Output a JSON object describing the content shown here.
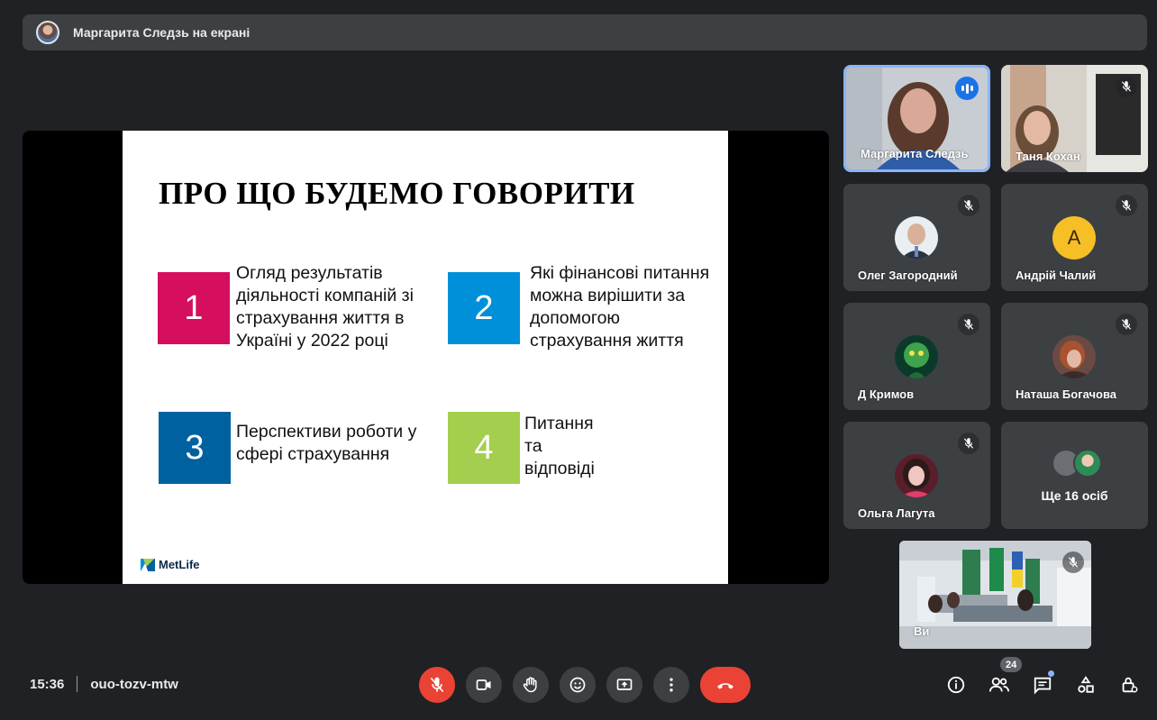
{
  "banner": {
    "text": "Маргарита Следзь на екрані"
  },
  "slide": {
    "title": "ПРО ЩО БУДЕМО ГОВОРИТИ",
    "items": [
      {
        "number": "1",
        "text": "Огляд результатів\nдіяльності компаній зі\nстрахування життя в\nУкраїні у 2022 році",
        "color": "#d50e5d"
      },
      {
        "number": "2",
        "text": "Які фінансові питання\nможна вирішити за\nдопомогою\nстрахування життя",
        "color": "#0090da"
      },
      {
        "number": "3",
        "text": "Перспективи роботи у\nсфері страхування",
        "color": "#0061a0"
      },
      {
        "number": "4",
        "text": "Питання\nта\nвідповіді",
        "color": "#a4ce4e"
      }
    ],
    "logo_text": "MetLife"
  },
  "participants": [
    {
      "name": "Маргарита Следзь"
    },
    {
      "name": "Таня Кохан"
    },
    {
      "name": "Олег Загородний"
    },
    {
      "name": "Андрій Чалий",
      "initial": "A"
    },
    {
      "name": "Д Кримов"
    },
    {
      "name": "Наташа Богачова"
    },
    {
      "name": "Ольга Лагута"
    },
    {
      "name": "Ще 16 осіб"
    },
    {
      "name": "Ви"
    }
  ],
  "meeting": {
    "time": "15:36",
    "code": "ouo-tozv-mtw",
    "participant_count": "24"
  },
  "colors": {
    "background": "#202124",
    "tile": "#3c4043",
    "accent": "#8ab4f8",
    "danger": "#ea4335"
  },
  "icons": [
    "mic-off-icon",
    "camera-icon",
    "raise-hand-icon",
    "emoji-icon",
    "present-icon",
    "more-icon",
    "end-call-icon",
    "info-icon",
    "people-icon",
    "chat-icon",
    "activities-icon",
    "host-controls-icon"
  ]
}
